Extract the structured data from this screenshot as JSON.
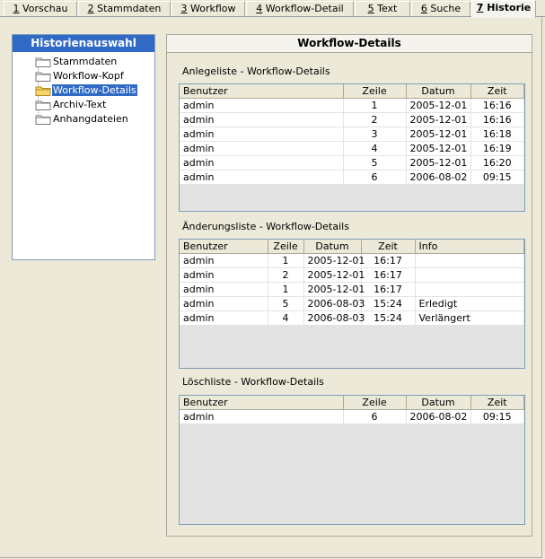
{
  "tabs": [
    {
      "key": "1",
      "label": " Vorschau"
    },
    {
      "key": "2",
      "label": " Stammdaten"
    },
    {
      "key": "3",
      "label": " Workflow"
    },
    {
      "key": "4",
      "label": " Workflow-Detail"
    },
    {
      "key": "5",
      "label": " Text"
    },
    {
      "key": "6",
      "label": " Suche"
    },
    {
      "key": "7",
      "label": " Historie"
    }
  ],
  "tree": {
    "title": "Historienauswahl",
    "items": [
      "Stammdaten",
      "Workflow-Kopf",
      "Workflow-Details",
      "Archiv-Text",
      "Anhangdateien"
    ],
    "selected_index": 2
  },
  "panel": {
    "title": "Workflow-Details",
    "anlege": {
      "label": "Anlegeliste - Workflow-Details",
      "headers": [
        "Benutzer",
        "Zeile",
        "Datum",
        "Zeit"
      ],
      "rows": [
        [
          "admin",
          "1",
          "2005-12-01",
          "16:16"
        ],
        [
          "admin",
          "2",
          "2005-12-01",
          "16:16"
        ],
        [
          "admin",
          "3",
          "2005-12-01",
          "16:18"
        ],
        [
          "admin",
          "4",
          "2005-12-01",
          "16:19"
        ],
        [
          "admin",
          "5",
          "2005-12-01",
          "16:20"
        ],
        [
          "admin",
          "6",
          "2006-08-02",
          "09:15"
        ]
      ]
    },
    "aenderung": {
      "label": "Änderungsliste - Workflow-Details",
      "headers": [
        "Benutzer",
        "Zeile",
        "Datum",
        "Zeit",
        "Info"
      ],
      "rows": [
        [
          "admin",
          "1",
          "2005-12-01",
          "16:17",
          ""
        ],
        [
          "admin",
          "2",
          "2005-12-01",
          "16:17",
          ""
        ],
        [
          "admin",
          "1",
          "2005-12-01",
          "16:17",
          ""
        ],
        [
          "admin",
          "5",
          "2006-08-03",
          "15:24",
          "Erledigt"
        ],
        [
          "admin",
          "4",
          "2006-08-03",
          "15:24",
          "Verlängert"
        ]
      ]
    },
    "loesch": {
      "label": "Löschliste - Workflow-Details",
      "headers": [
        "Benutzer",
        "Zeile",
        "Datum",
        "Zeit"
      ],
      "rows": [
        [
          "admin",
          "6",
          "2006-08-02",
          "09:15"
        ]
      ]
    }
  }
}
